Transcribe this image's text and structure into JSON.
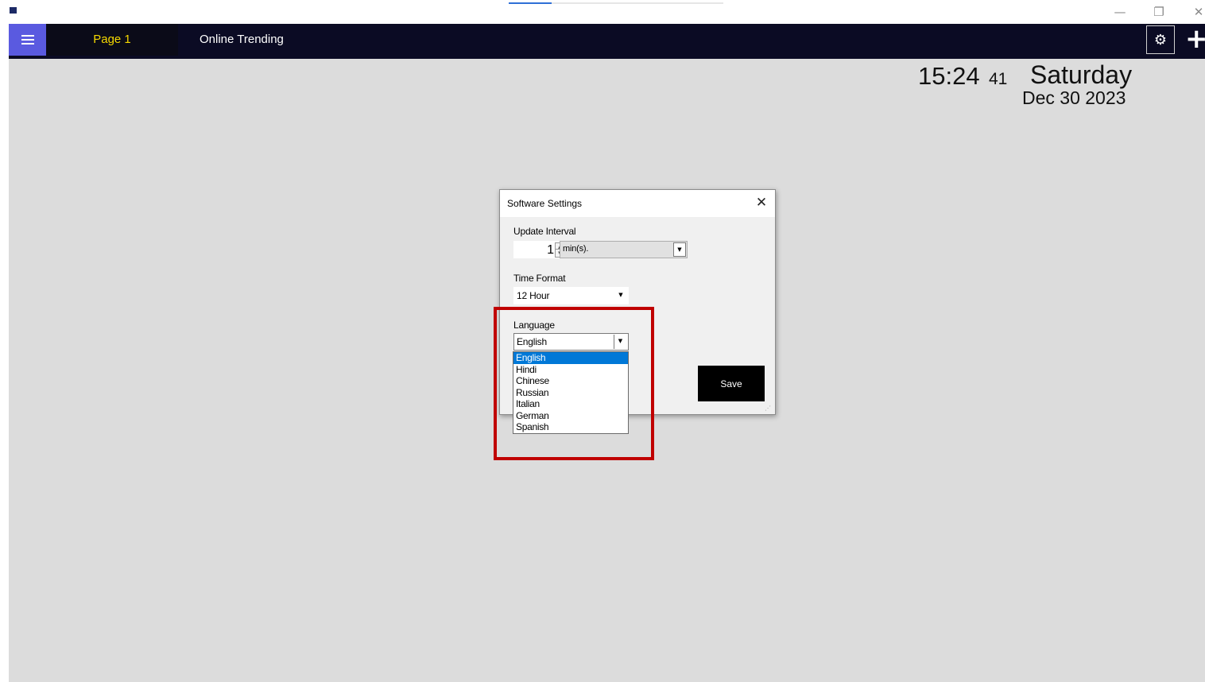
{
  "window": {
    "minimize_glyph": "—",
    "restore_glyph": "❐",
    "close_glyph": "✕"
  },
  "header": {
    "tabs": [
      {
        "label": "Page 1"
      },
      {
        "label": "Online Trending"
      }
    ],
    "settings_icon": "gear-icon",
    "add_glyph": "+"
  },
  "clock": {
    "time": "15:24",
    "seconds": "41",
    "day": "Saturday",
    "date": "Dec 30 2023"
  },
  "dialog": {
    "title": "Software Settings",
    "close_glyph": "✕",
    "update_interval": {
      "label": "Update Interval",
      "value": "1",
      "unit": "min(s)."
    },
    "time_format": {
      "label": "Time Format",
      "value": "12 Hour"
    },
    "language": {
      "label": "Language",
      "value": "English",
      "options": [
        "English",
        "Hindi",
        "Chinese",
        "Russian",
        "Italian",
        "German",
        "Spanish"
      ],
      "selected_index": 0
    },
    "save_label": "Save"
  },
  "colors": {
    "header_bg": "#0b0b24",
    "menu_button_bg": "#5a5ae0",
    "active_tab_text": "#f5d800",
    "main_bg": "#dcdcdc",
    "selection": "#0078d7",
    "highlight": "#c00000"
  }
}
